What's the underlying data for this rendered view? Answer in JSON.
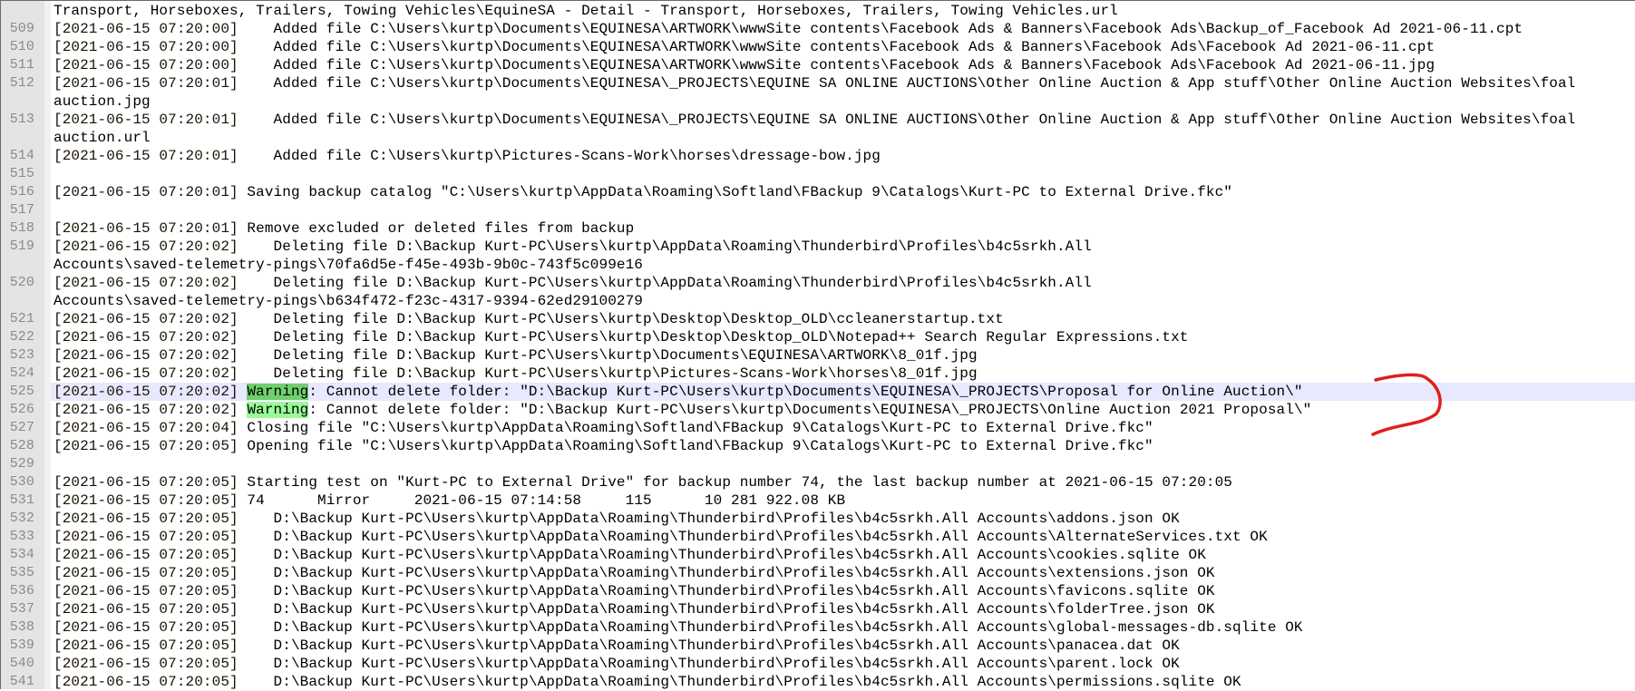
{
  "editor": {
    "colors": {
      "current_line": "#e8e8ff",
      "warning_current": "#6fcf6f",
      "warning": "#98fb98",
      "bracket": "#8a4a00",
      "annotation": "#e0201c"
    },
    "current_line": "525",
    "lines": [
      {
        "n": "",
        "text": "Transport, Horseboxes, Trailers, Towing Vehicles\\EquineSA - Detail - Transport, Horseboxes, Trailers, Towing Vehicles.url"
      },
      {
        "n": "509",
        "ts": "[2021-06-15 07:20:00]",
        "text": "    Added file C:\\Users\\kurtp\\Documents\\EQUINESA\\ARTWORK\\wwwSite contents\\Facebook Ads & Banners\\Facebook Ads\\Backup_of_Facebook Ad 2021-06-11.cpt"
      },
      {
        "n": "510",
        "ts": "[2021-06-15 07:20:00]",
        "text": "    Added file C:\\Users\\kurtp\\Documents\\EQUINESA\\ARTWORK\\wwwSite contents\\Facebook Ads & Banners\\Facebook Ads\\Facebook Ad 2021-06-11.cpt"
      },
      {
        "n": "511",
        "ts": "[2021-06-15 07:20:00]",
        "text": "    Added file C:\\Users\\kurtp\\Documents\\EQUINESA\\ARTWORK\\wwwSite contents\\Facebook Ads & Banners\\Facebook Ads\\Facebook Ad 2021-06-11.jpg"
      },
      {
        "n": "512",
        "ts": "[2021-06-15 07:20:01]",
        "text": "    Added file C:\\Users\\kurtp\\Documents\\EQUINESA\\_PROJECTS\\EQUINE SA ONLINE AUCTIONS\\Other Online Auction & App stuff\\Other Online Auction Websites\\foal",
        "cont": "auction.jpg"
      },
      {
        "n": "513",
        "ts": "[2021-06-15 07:20:01]",
        "text": "    Added file C:\\Users\\kurtp\\Documents\\EQUINESA\\_PROJECTS\\EQUINE SA ONLINE AUCTIONS\\Other Online Auction & App stuff\\Other Online Auction Websites\\foal",
        "cont": "auction.url"
      },
      {
        "n": "514",
        "ts": "[2021-06-15 07:20:01]",
        "text": "    Added file C:\\Users\\kurtp\\Pictures-Scans-Work\\horses\\dressage-bow.jpg"
      },
      {
        "n": "515",
        "text": ""
      },
      {
        "n": "516",
        "ts": "[2021-06-15 07:20:01]",
        "text": " Saving backup catalog \"C:\\Users\\kurtp\\AppData\\Roaming\\Softland\\FBackup 9\\Catalogs\\Kurt-PC to External Drive.fkc\""
      },
      {
        "n": "517",
        "text": ""
      },
      {
        "n": "518",
        "ts": "[2021-06-15 07:20:01]",
        "text": " Remove excluded or deleted files from backup"
      },
      {
        "n": "519",
        "ts": "[2021-06-15 07:20:02]",
        "text": "    Deleting file D:\\Backup Kurt-PC\\Users\\kurtp\\AppData\\Roaming\\Thunderbird\\Profiles\\b4c5srkh.All",
        "cont": "Accounts\\saved-telemetry-pings\\70fa6d5e-f45e-493b-9b0c-743f5c099e16"
      },
      {
        "n": "520",
        "ts": "[2021-06-15 07:20:02]",
        "text": "    Deleting file D:\\Backup Kurt-PC\\Users\\kurtp\\AppData\\Roaming\\Thunderbird\\Profiles\\b4c5srkh.All",
        "cont": "Accounts\\saved-telemetry-pings\\b634f472-f23c-4317-9394-62ed29100279"
      },
      {
        "n": "521",
        "ts": "[2021-06-15 07:20:02]",
        "text": "    Deleting file D:\\Backup Kurt-PC\\Users\\kurtp\\Desktop\\Desktop_OLD\\ccleanerstartup.txt"
      },
      {
        "n": "522",
        "ts": "[2021-06-15 07:20:02]",
        "text": "    Deleting file D:\\Backup Kurt-PC\\Users\\kurtp\\Desktop\\Desktop_OLD\\Notepad++ Search Regular Expressions.txt"
      },
      {
        "n": "523",
        "ts": "[2021-06-15 07:20:02]",
        "text": "    Deleting file D:\\Backup Kurt-PC\\Users\\kurtp\\Documents\\EQUINESA\\ARTWORK\\8_01f.jpg"
      },
      {
        "n": "524",
        "ts": "[2021-06-15 07:20:02]",
        "text": "    Deleting file D:\\Backup Kurt-PC\\Users\\kurtp\\Pictures-Scans-Work\\horses\\8_01f.jpg"
      },
      {
        "n": "525",
        "ts": "[2021-06-15 07:20:02]",
        "kw": "Warning",
        "text": ": Cannot delete folder: \"D:\\Backup Kurt-PC\\Users\\kurtp\\Documents\\EQUINESA\\_PROJECTS\\Proposal for Online Auction\\\""
      },
      {
        "n": "526",
        "ts": "[2021-06-15 07:20:02]",
        "kw": "Warning",
        "text": ": Cannot delete folder: \"D:\\Backup Kurt-PC\\Users\\kurtp\\Documents\\EQUINESA\\_PROJECTS\\Online Auction 2021 Proposal\\\""
      },
      {
        "n": "527",
        "ts": "[2021-06-15 07:20:04]",
        "text": " Closing file \"C:\\Users\\kurtp\\AppData\\Roaming\\Softland\\FBackup 9\\Catalogs\\Kurt-PC to External Drive.fkc\""
      },
      {
        "n": "528",
        "ts": "[2021-06-15 07:20:05]",
        "text": " Opening file \"C:\\Users\\kurtp\\AppData\\Roaming\\Softland\\FBackup 9\\Catalogs\\Kurt-PC to External Drive.fkc\""
      },
      {
        "n": "529",
        "text": ""
      },
      {
        "n": "530",
        "ts": "[2021-06-15 07:20:05]",
        "text": " Starting test on \"Kurt-PC to External Drive\" for backup number 74, the last backup number at 2021-06-15 07:20:05"
      },
      {
        "n": "531",
        "ts": "[2021-06-15 07:20:05]",
        "text": " 74      Mirror     2021-06-15 07:14:58     115      10 281 922.08 KB"
      },
      {
        "n": "532",
        "ts": "[2021-06-15 07:20:05]",
        "text": "    D:\\Backup Kurt-PC\\Users\\kurtp\\AppData\\Roaming\\Thunderbird\\Profiles\\b4c5srkh.All Accounts\\addons.json OK"
      },
      {
        "n": "533",
        "ts": "[2021-06-15 07:20:05]",
        "text": "    D:\\Backup Kurt-PC\\Users\\kurtp\\AppData\\Roaming\\Thunderbird\\Profiles\\b4c5srkh.All Accounts\\AlternateServices.txt OK"
      },
      {
        "n": "534",
        "ts": "[2021-06-15 07:20:05]",
        "text": "    D:\\Backup Kurt-PC\\Users\\kurtp\\AppData\\Roaming\\Thunderbird\\Profiles\\b4c5srkh.All Accounts\\cookies.sqlite OK"
      },
      {
        "n": "535",
        "ts": "[2021-06-15 07:20:05]",
        "text": "    D:\\Backup Kurt-PC\\Users\\kurtp\\AppData\\Roaming\\Thunderbird\\Profiles\\b4c5srkh.All Accounts\\extensions.json OK"
      },
      {
        "n": "536",
        "ts": "[2021-06-15 07:20:05]",
        "text": "    D:\\Backup Kurt-PC\\Users\\kurtp\\AppData\\Roaming\\Thunderbird\\Profiles\\b4c5srkh.All Accounts\\favicons.sqlite OK"
      },
      {
        "n": "537",
        "ts": "[2021-06-15 07:20:05]",
        "text": "    D:\\Backup Kurt-PC\\Users\\kurtp\\AppData\\Roaming\\Thunderbird\\Profiles\\b4c5srkh.All Accounts\\folderTree.json OK"
      },
      {
        "n": "538",
        "ts": "[2021-06-15 07:20:05]",
        "text": "    D:\\Backup Kurt-PC\\Users\\kurtp\\AppData\\Roaming\\Thunderbird\\Profiles\\b4c5srkh.All Accounts\\global-messages-db.sqlite OK"
      },
      {
        "n": "539",
        "ts": "[2021-06-15 07:20:05]",
        "text": "    D:\\Backup Kurt-PC\\Users\\kurtp\\AppData\\Roaming\\Thunderbird\\Profiles\\b4c5srkh.All Accounts\\panacea.dat OK"
      },
      {
        "n": "540",
        "ts": "[2021-06-15 07:20:05]",
        "text": "    D:\\Backup Kurt-PC\\Users\\kurtp\\AppData\\Roaming\\Thunderbird\\Profiles\\b4c5srkh.All Accounts\\parent.lock OK"
      },
      {
        "n": "541",
        "ts": "[2021-06-15 07:20:05]",
        "text": "    D:\\Backup Kurt-PC\\Users\\kurtp\\AppData\\Roaming\\Thunderbird\\Profiles\\b4c5srkh.All Accounts\\permissions.sqlite OK"
      }
    ]
  }
}
